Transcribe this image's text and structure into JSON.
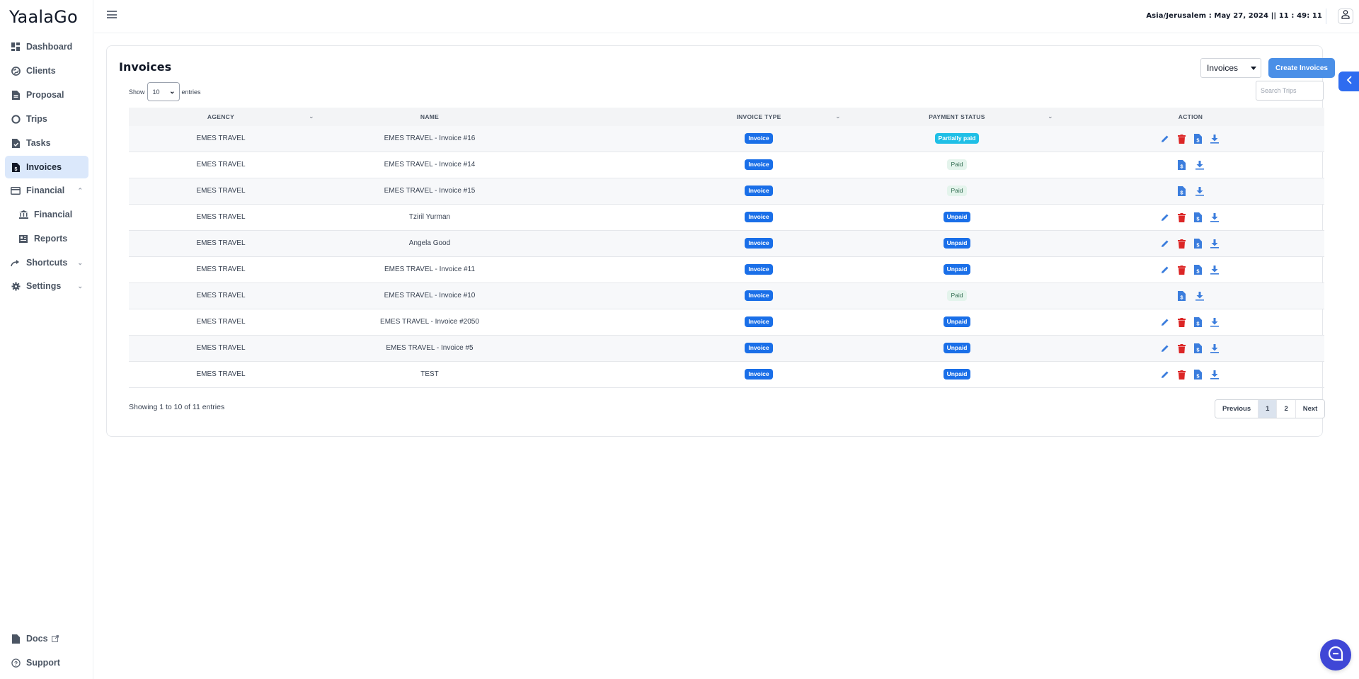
{
  "brand": "YaalaGo",
  "sidebar": {
    "items": [
      {
        "label": "Dashboard",
        "icon": "dashboard-icon"
      },
      {
        "label": "Clients",
        "icon": "globe-icon"
      },
      {
        "label": "Proposal",
        "icon": "document-icon"
      },
      {
        "label": "Trips",
        "icon": "circle-icon"
      },
      {
        "label": "Tasks",
        "icon": "task-icon"
      },
      {
        "label": "Invoices",
        "icon": "invoice-icon",
        "active": true
      },
      {
        "label": "Financial",
        "icon": "credit-card-icon",
        "expanded": true
      },
      {
        "label": "Financial",
        "icon": "bank-icon",
        "sub": true
      },
      {
        "label": "Reports",
        "icon": "reports-icon",
        "sub": true
      },
      {
        "label": "Shortcuts",
        "icon": "share-icon"
      },
      {
        "label": "Settings",
        "icon": "gear-icon"
      }
    ],
    "bottom": [
      {
        "label": "Docs",
        "icon": "document-icon"
      },
      {
        "label": "Support",
        "icon": "help-icon"
      }
    ]
  },
  "topbar": {
    "clock": "Asia/Jerusalem : May 27, 2024 || 11 : 49: 11"
  },
  "card": {
    "title": "Invoices",
    "type_select": "Invoices",
    "create_label": "Create Invoices",
    "search_placeholder": "Search Trips",
    "show_label": "Show",
    "entries_label": "entries",
    "page_length": "10"
  },
  "table": {
    "columns": [
      "AGENCY",
      "NAME",
      "INVOICE TYPE",
      "PAYMENT STATUS",
      "ACTION"
    ],
    "rows": [
      {
        "agency": "EMES TRAVEL",
        "name": "EMES TRAVEL - Invoice #16",
        "type": "Invoice",
        "status": "Partially paid",
        "status_kind": "partial",
        "actions": [
          "edit",
          "delete",
          "invoice",
          "download"
        ]
      },
      {
        "agency": "EMES TRAVEL",
        "name": "EMES TRAVEL - Invoice #14",
        "type": "Invoice",
        "status": "Paid",
        "status_kind": "paid",
        "actions": [
          "invoice",
          "download"
        ]
      },
      {
        "agency": "EMES TRAVEL",
        "name": "EMES TRAVEL - Invoice #15",
        "type": "Invoice",
        "status": "Paid",
        "status_kind": "paid",
        "actions": [
          "invoice",
          "download"
        ]
      },
      {
        "agency": "EMES TRAVEL",
        "name": "Tziril Yurman",
        "type": "Invoice",
        "status": "Unpaid",
        "status_kind": "unpaid",
        "actions": [
          "edit",
          "delete",
          "invoice",
          "download"
        ]
      },
      {
        "agency": "EMES TRAVEL",
        "name": "Angela Good",
        "type": "Invoice",
        "status": "Unpaid",
        "status_kind": "unpaid",
        "actions": [
          "edit",
          "delete",
          "invoice",
          "download"
        ]
      },
      {
        "agency": "EMES TRAVEL",
        "name": "EMES TRAVEL - Invoice #11",
        "type": "Invoice",
        "status": "Unpaid",
        "status_kind": "unpaid",
        "actions": [
          "edit",
          "delete",
          "invoice",
          "download"
        ]
      },
      {
        "agency": "EMES TRAVEL",
        "name": "EMES TRAVEL - Invoice #10",
        "type": "Invoice",
        "status": "Paid",
        "status_kind": "paid",
        "actions": [
          "invoice",
          "download"
        ]
      },
      {
        "agency": "EMES TRAVEL",
        "name": "EMES TRAVEL - Invoice #2050",
        "type": "Invoice",
        "status": "Unpaid",
        "status_kind": "unpaid",
        "actions": [
          "edit",
          "delete",
          "invoice",
          "download"
        ]
      },
      {
        "agency": "EMES TRAVEL",
        "name": "EMES TRAVEL - Invoice #5",
        "type": "Invoice",
        "status": "Unpaid",
        "status_kind": "unpaid",
        "actions": [
          "edit",
          "delete",
          "invoice",
          "download"
        ]
      },
      {
        "agency": "EMES TRAVEL",
        "name": "TEST",
        "type": "Invoice",
        "status": "Unpaid",
        "status_kind": "unpaid",
        "actions": [
          "edit",
          "delete",
          "invoice",
          "download"
        ]
      }
    ]
  },
  "footer": {
    "info": "Showing 1 to 10 of 11 entries",
    "pagination": {
      "previous": "Previous",
      "pages": [
        "1",
        "2"
      ],
      "current": "1",
      "next": "Next"
    }
  },
  "colors": {
    "accent": "#4a8fe7",
    "badge_blue": "#1a6fe8",
    "badge_cyan": "#1fbfe6",
    "delete_red": "#dc2626",
    "chat_fab": "#3f47d6"
  }
}
